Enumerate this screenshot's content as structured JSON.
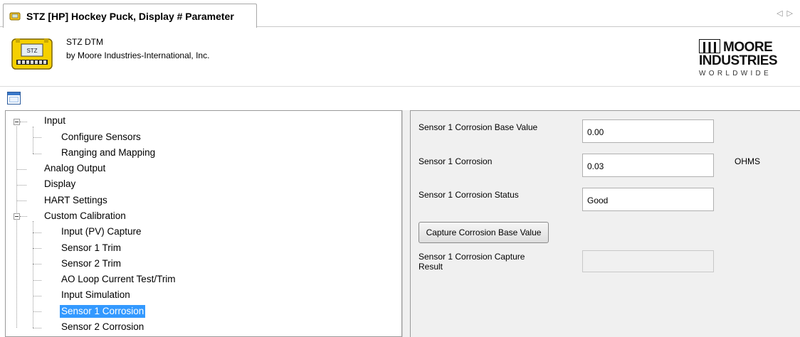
{
  "tab": {
    "title": "STZ [HP] Hockey Puck, Display # Parameter",
    "icon": "device-tag-icon",
    "nav_prev": "◁",
    "nav_next": "▷"
  },
  "header": {
    "dtm_name": "STZ DTM",
    "vendor": "by Moore Industries-International, Inc.",
    "device_image": "stz-device-icon",
    "brand": {
      "line1": "MOORE",
      "line2": "INDUSTRIES",
      "line3": "WORLDWIDE"
    }
  },
  "toolbar": {
    "window_icon": "window-icon"
  },
  "tree": {
    "items": [
      {
        "label": "Input",
        "level": 0,
        "expanded": true
      },
      {
        "label": "Configure Sensors",
        "level": 1
      },
      {
        "label": "Ranging and Mapping",
        "level": 1
      },
      {
        "label": "Analog Output",
        "level": 0
      },
      {
        "label": "Display",
        "level": 0
      },
      {
        "label": "HART Settings",
        "level": 0
      },
      {
        "label": "Custom Calibration",
        "level": 0,
        "expanded": true
      },
      {
        "label": "Input (PV) Capture",
        "level": 1
      },
      {
        "label": "Sensor 1 Trim",
        "level": 1
      },
      {
        "label": "Sensor 2 Trim",
        "level": 1
      },
      {
        "label": "AO Loop Current Test/Trim",
        "level": 1
      },
      {
        "label": "Input Simulation",
        "level": 1
      },
      {
        "label": "Sensor 1 Corrosion",
        "level": 1,
        "selected": true
      },
      {
        "label": "Sensor 2 Corrosion",
        "level": 1
      }
    ]
  },
  "params": {
    "base_value": {
      "label": "Sensor 1 Corrosion Base Value",
      "value": "0.00"
    },
    "corrosion": {
      "label": "Sensor 1 Corrosion",
      "value": "0.03",
      "unit": "OHMS"
    },
    "status": {
      "label": "Sensor 1 Corrosion Status",
      "value": "Good"
    },
    "capture_button": "Capture Corrosion Base Value",
    "capture_result": {
      "label_line1": "Sensor 1 Corrosion Capture",
      "label_line2": "Result",
      "value": ""
    }
  },
  "colors": {
    "selection": "#3399ff",
    "pane_background": "#f0f0f0",
    "accent_blue": "#3a78c9"
  }
}
